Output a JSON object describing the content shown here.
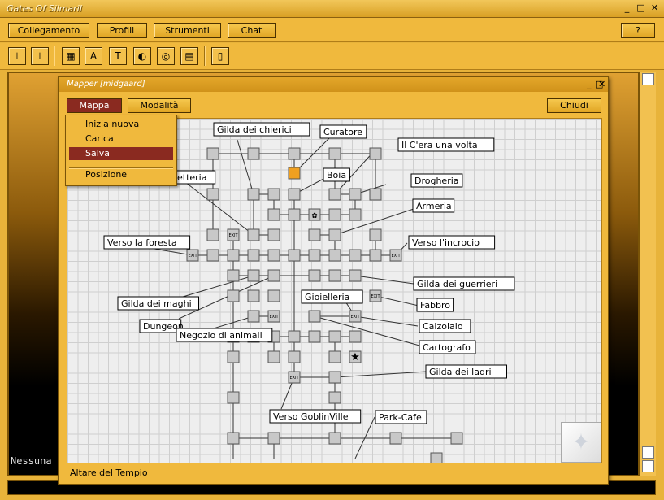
{
  "window": {
    "title": "Gates Of Silmaril",
    "controls": [
      "_",
      "□",
      "✕"
    ]
  },
  "menubar": {
    "buttons": [
      "Collegamento",
      "Profili",
      "Strumenti",
      "Chat"
    ],
    "help": "?"
  },
  "toolbar": {
    "icons": [
      "connect-icon",
      "disconnect-icon",
      "map-icon",
      "aliases-icon",
      "triggers-icon",
      "settings-icon",
      "color-icon",
      "notes-icon",
      "exit-icon"
    ],
    "glyphs": [
      "⊥",
      "⊥",
      "▦",
      "A",
      "T",
      "◐",
      "◎",
      "▤",
      "▯"
    ]
  },
  "output": {
    "text": "Nessuna"
  },
  "mapper": {
    "title": "Mapper [midgaard]",
    "controls": [
      "_",
      "□",
      "✕"
    ],
    "menu_mappa": "Mappa",
    "menu_modalita": "Modalità",
    "close_button": "Chiudi",
    "status": "Altare del Tempio",
    "dropdown": {
      "items": [
        "Inizia nuova",
        "Carica",
        "Salva"
      ],
      "selected": "Salva",
      "extra": "Posizione"
    },
    "map_labels": [
      "Gilda dei chierici",
      "Curatore",
      "Il C'era una volta",
      "Boia",
      "Drogheria",
      "Armeria",
      "etteria",
      "Verso la foresta",
      "Verso l'incrocio",
      "Gilda dei guerrieri",
      "Gilda dei maghi",
      "Dungeon",
      "Gioielleria",
      "Fabbro",
      "Negozio di animali",
      "Calzolaio",
      "Cartografo",
      "Gilda dei ladri",
      "Verso GoblinVille",
      "Park-Cafe"
    ],
    "exit_label": "EXIT",
    "colors": {
      "current_room": "#f0a020",
      "room": "#c8c8c8",
      "selected": "#8a2a20"
    }
  }
}
